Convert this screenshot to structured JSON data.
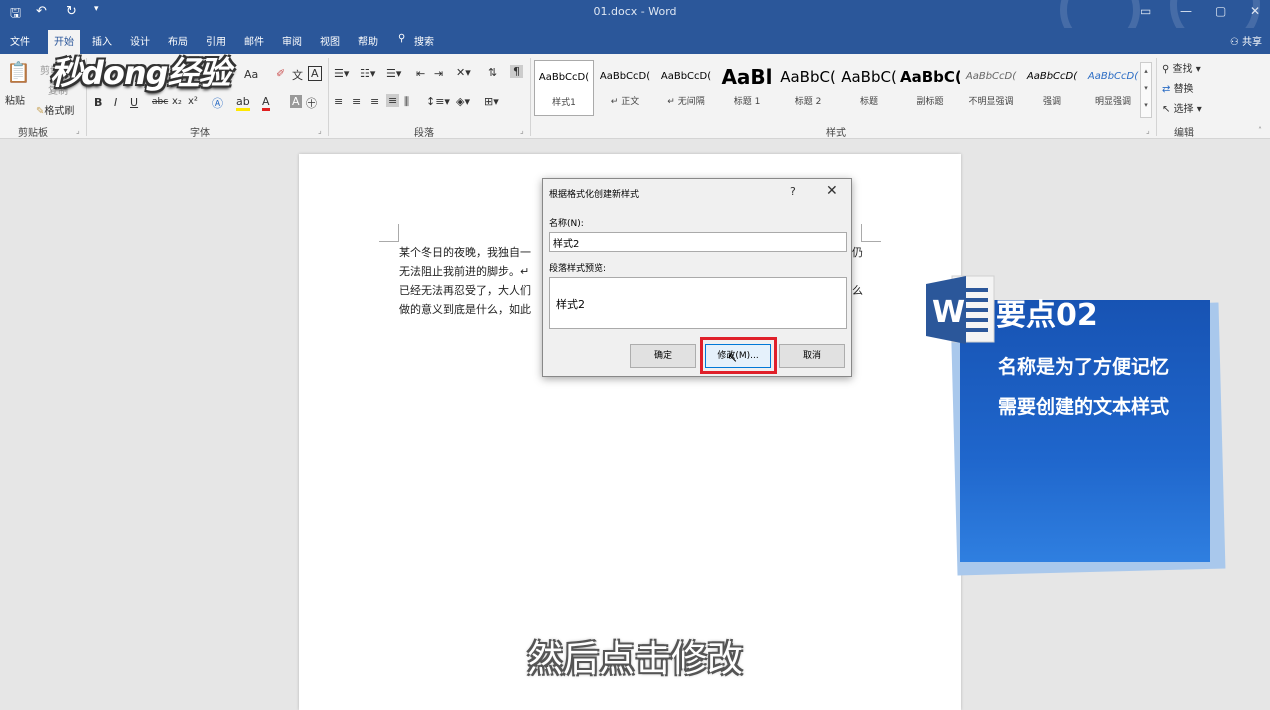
{
  "app": {
    "window_title": "01.docx - Word",
    "quick_access": {
      "save_icon": "save-icon",
      "undo": "↶",
      "redo": "↻"
    }
  },
  "tabs": [
    "文件",
    "开始",
    "插入",
    "设计",
    "布局",
    "引用",
    "邮件",
    "审阅",
    "视图",
    "帮助"
  ],
  "tell_me": "搜索",
  "share": "共享",
  "ribbon": {
    "clipboard": {
      "paste": "粘贴",
      "cut": "剪切",
      "copy": "复制",
      "format_painter": "格式刷",
      "label": "剪贴板"
    },
    "font": {
      "label": "字体",
      "bold": "B",
      "italic": "I",
      "underline": "U",
      "strike": "abc",
      "sub": "x₂",
      "sup": "x²",
      "font_size_aa": "Aa",
      "wen": "文"
    },
    "paragraph": {
      "label": "段落"
    },
    "styles": {
      "label": "样式",
      "items": [
        {
          "sample": "AaBbCcD(",
          "name": "样式1"
        },
        {
          "sample": "AaBbCcD(",
          "name": "↵ 正文"
        },
        {
          "sample": "AaBbCcD(",
          "name": "↵ 无间隔"
        },
        {
          "sample": "AaBl",
          "name": "标题 1"
        },
        {
          "sample": "AaBbC(",
          "name": "标题 2"
        },
        {
          "sample": "AaBbC(",
          "name": "标题"
        },
        {
          "sample": "AaBbC(",
          "name": "副标题"
        },
        {
          "sample": "AaBbCcD(",
          "name": "不明显强调"
        },
        {
          "sample": "AaBbCcD(",
          "name": "强调"
        },
        {
          "sample": "AaBbCcD(",
          "name": "明显强调"
        }
      ]
    },
    "editing": {
      "label": "编辑",
      "find": "查找",
      "replace": "替换",
      "select": "选择"
    }
  },
  "document": {
    "lines": [
      "某个冬日的夜晚，我独自一",
      "无法阻止我前进的脚步。↵",
      "已经无法再忍受了，大人们",
      "做的意义到底是什么，如此"
    ],
    "right_fragments": [
      "仍",
      "么"
    ]
  },
  "dialog": {
    "title": "根据格式化创建新样式",
    "help": "?",
    "close": "✕",
    "name_label": "名称(N):",
    "name_value": "样式2",
    "preview_label": "段落样式预览:",
    "preview_text": "样式2",
    "ok": "确定",
    "modify": "修改(M)...",
    "cancel": "取消"
  },
  "watermark": "秒dong经验",
  "callout": {
    "heading": "要点02",
    "lines": [
      "名称是为了方便记忆",
      "需要创建的文本样式"
    ]
  },
  "caption": "然后点击修改",
  "colors": {
    "titlebar": "#2b579a",
    "callout": "#1f66cc",
    "highlight": "#e0202a"
  }
}
